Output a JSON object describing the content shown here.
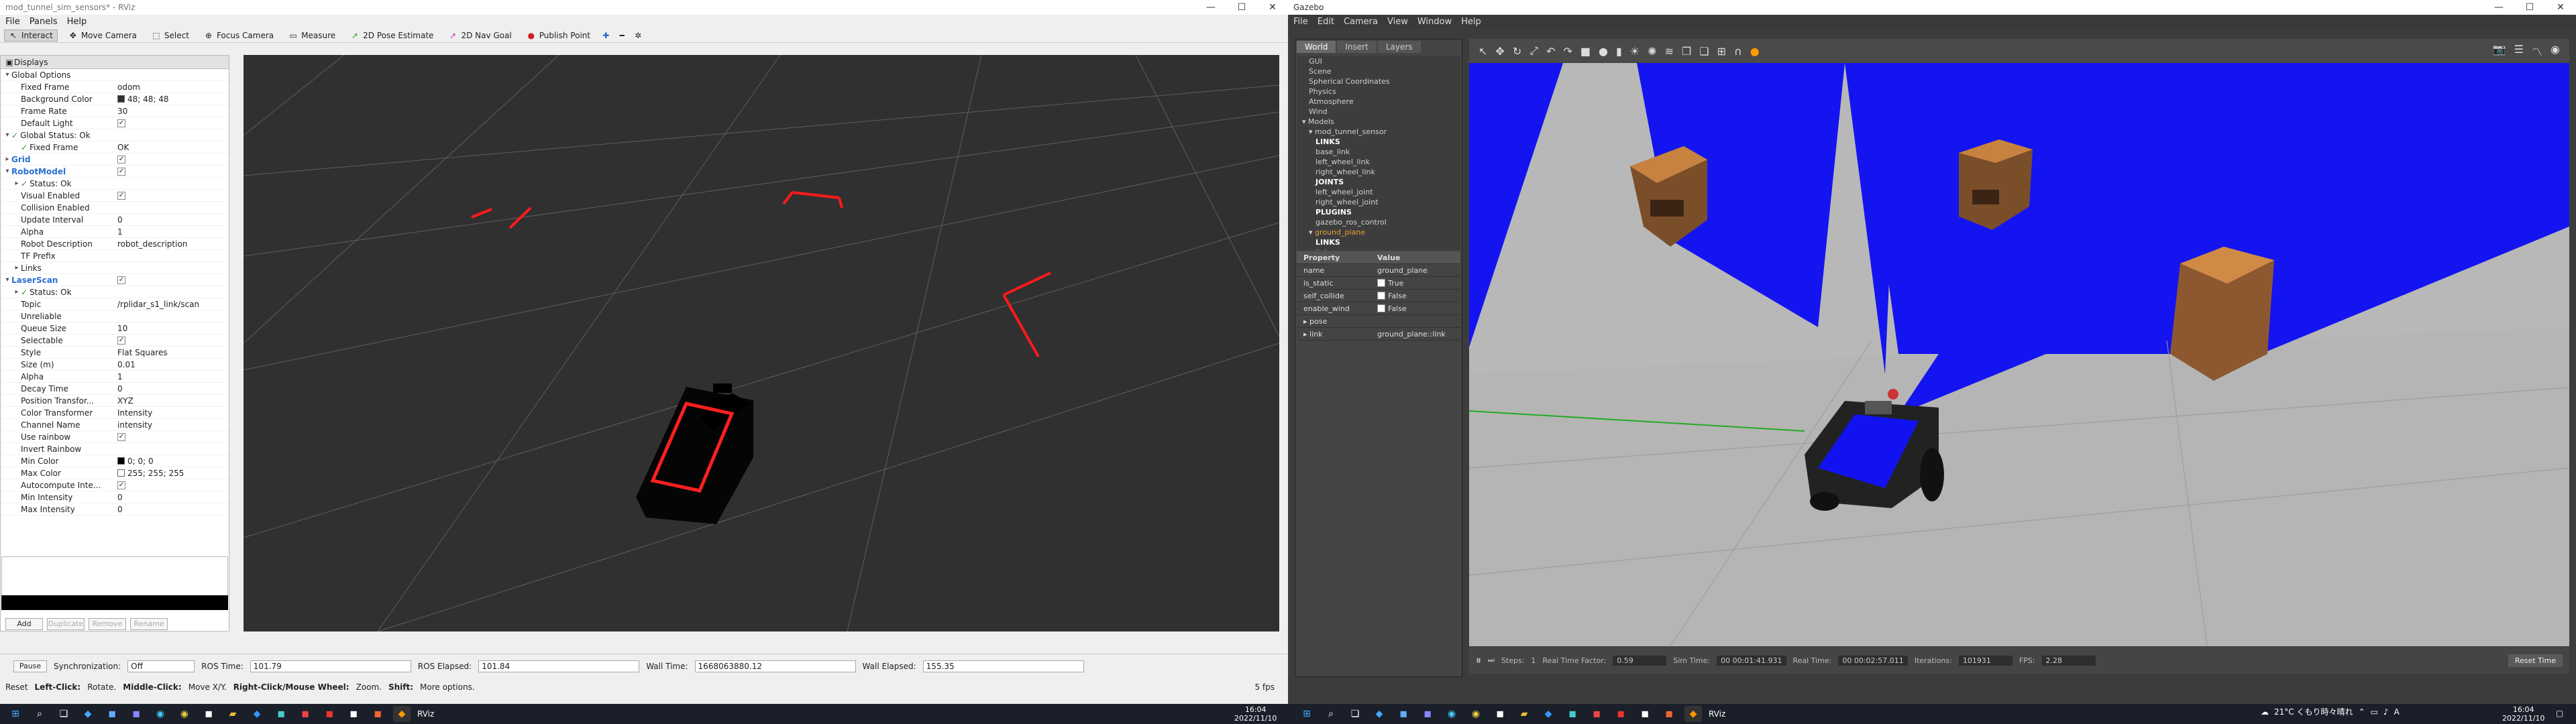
{
  "rviz": {
    "title": "mod_tunnel_sim_sensors* - RViz",
    "menu": [
      "File",
      "Panels",
      "Help"
    ],
    "toolbar": [
      "Interact",
      "Move Camera",
      "Select",
      "Focus Camera",
      "Measure",
      "2D Pose Estimate",
      "2D Nav Goal",
      "Publish Point"
    ],
    "displays_title": "Displays",
    "rows": [
      {
        "n": "Global Options",
        "v": "",
        "lvl": 0,
        "arrow": "▾",
        "icon": "gear"
      },
      {
        "n": "Fixed Frame",
        "v": "odom",
        "lvl": 1
      },
      {
        "n": "Background Color",
        "v": "48; 48; 48",
        "lvl": 1,
        "swatch": "#303030"
      },
      {
        "n": "Frame Rate",
        "v": "30",
        "lvl": 1
      },
      {
        "n": "Default Light",
        "v": "",
        "lvl": 1,
        "check": true
      },
      {
        "n": "Global Status: Ok",
        "v": "",
        "lvl": 0,
        "arrow": "▾",
        "ok": true
      },
      {
        "n": "Fixed Frame",
        "v": "OK",
        "lvl": 1,
        "ok": true
      },
      {
        "n": "Grid",
        "v": "",
        "lvl": 0,
        "arrow": "▸",
        "blue": true,
        "check": true
      },
      {
        "n": "RobotModel",
        "v": "",
        "lvl": 0,
        "arrow": "▾",
        "blue": true,
        "check": true
      },
      {
        "n": "Status: Ok",
        "v": "",
        "lvl": 1,
        "arrow": "▸",
        "ok": true
      },
      {
        "n": "Visual Enabled",
        "v": "",
        "lvl": 1,
        "check": true
      },
      {
        "n": "Collision Enabled",
        "v": "",
        "lvl": 1
      },
      {
        "n": "Update Interval",
        "v": "0",
        "lvl": 1
      },
      {
        "n": "Alpha",
        "v": "1",
        "lvl": 1
      },
      {
        "n": "Robot Description",
        "v": "robot_description",
        "lvl": 1
      },
      {
        "n": "TF Prefix",
        "v": "",
        "lvl": 1
      },
      {
        "n": "Links",
        "v": "",
        "lvl": 1,
        "arrow": "▸"
      },
      {
        "n": "LaserScan",
        "v": "",
        "lvl": 0,
        "arrow": "▾",
        "blue": true,
        "check": true
      },
      {
        "n": "Status: Ok",
        "v": "",
        "lvl": 1,
        "arrow": "▸",
        "ok": true
      },
      {
        "n": "Topic",
        "v": "/rplidar_s1_link/scan",
        "lvl": 1
      },
      {
        "n": "Unreliable",
        "v": "",
        "lvl": 1
      },
      {
        "n": "Queue Size",
        "v": "10",
        "lvl": 1
      },
      {
        "n": "Selectable",
        "v": "",
        "lvl": 1,
        "check": true
      },
      {
        "n": "Style",
        "v": "Flat Squares",
        "lvl": 1
      },
      {
        "n": "Size (m)",
        "v": "0.01",
        "lvl": 1
      },
      {
        "n": "Alpha",
        "v": "1",
        "lvl": 1
      },
      {
        "n": "Decay Time",
        "v": "0",
        "lvl": 1
      },
      {
        "n": "Position Transfor...",
        "v": "XYZ",
        "lvl": 1
      },
      {
        "n": "Color Transformer",
        "v": "Intensity",
        "lvl": 1
      },
      {
        "n": "Channel Name",
        "v": "intensity",
        "lvl": 1
      },
      {
        "n": "Use rainbow",
        "v": "",
        "lvl": 1,
        "check": true
      },
      {
        "n": "Invert Rainbow",
        "v": "",
        "lvl": 1
      },
      {
        "n": "Min Color",
        "v": "0; 0; 0",
        "lvl": 1,
        "swatch": "#000000"
      },
      {
        "n": "Max Color",
        "v": "255; 255; 255",
        "lvl": 1,
        "swatch": "#ffffff"
      },
      {
        "n": "Autocompute Inte...",
        "v": "",
        "lvl": 1,
        "check": true
      },
      {
        "n": "Min Intensity",
        "v": "0",
        "lvl": 1
      },
      {
        "n": "Max Intensity",
        "v": "0",
        "lvl": 1
      }
    ],
    "panel_buttons": [
      "Add",
      "Duplicate",
      "Remove",
      "Rename"
    ],
    "time": {
      "pause": "Pause",
      "sync_label": "Synchronization:",
      "sync_val": "Off",
      "ros_time_label": "ROS Time:",
      "ros_time": "101.79",
      "ros_elapsed_label": "ROS Elapsed:",
      "ros_elapsed": "101.84",
      "wall_time_label": "Wall Time:",
      "wall_time": "1668063880.12",
      "wall_elapsed_label": "Wall Elapsed:",
      "wall_elapsed": "155.35"
    },
    "status": {
      "reset": "Reset",
      "hint_bold1": "Left-Click:",
      "hint1": "Rotate.",
      "hint_bold2": "Middle-Click:",
      "hint2": "Move X/Y.",
      "hint_bold3": "Right-Click/Mouse Wheel:",
      "hint3": "Zoom.",
      "hint_bold4": "Shift:",
      "hint4": "More options.",
      "fps": "5 fps"
    }
  },
  "gazebo": {
    "title": "Gazebo",
    "menu": [
      "File",
      "Edit",
      "Camera",
      "View",
      "Window",
      "Help"
    ],
    "tabs": [
      "World",
      "Insert",
      "Layers"
    ],
    "tree": [
      {
        "t": "GUI",
        "l": 1
      },
      {
        "t": "Scene",
        "l": 1
      },
      {
        "t": "Spherical Coordinates",
        "l": 1
      },
      {
        "t": "Physics",
        "l": 1
      },
      {
        "t": "Atmosphere",
        "l": 1
      },
      {
        "t": "Wind",
        "l": 1
      },
      {
        "t": "Models",
        "l": 0,
        "a": "▾"
      },
      {
        "t": "mod_tunnel_sensor",
        "l": 1,
        "a": "▾"
      },
      {
        "t": "LINKS",
        "l": 2,
        "b": true
      },
      {
        "t": "base_link",
        "l": 2
      },
      {
        "t": "left_wheel_link",
        "l": 2
      },
      {
        "t": "right_wheel_link",
        "l": 2
      },
      {
        "t": "JOINTS",
        "l": 2,
        "b": true
      },
      {
        "t": "left_wheel_joint",
        "l": 2
      },
      {
        "t": "right_wheel_joint",
        "l": 2
      },
      {
        "t": "PLUGINS",
        "l": 2,
        "b": true
      },
      {
        "t": "gazebo_ros_control",
        "l": 2
      },
      {
        "t": "ground_plane",
        "l": 1,
        "a": "▾",
        "o": true
      },
      {
        "t": "LINKS",
        "l": 2,
        "b": true
      },
      {
        "t": "link",
        "l": 2
      }
    ],
    "prop_head": [
      "Property",
      "Value"
    ],
    "props": [
      {
        "p": "name",
        "v": "ground_plane"
      },
      {
        "p": "is_static",
        "v": "True",
        "c": true
      },
      {
        "p": "self_collide",
        "v": "False",
        "c": false
      },
      {
        "p": "enable_wind",
        "v": "False",
        "c": false
      },
      {
        "p": "pose",
        "v": "",
        "a": "▸"
      },
      {
        "p": "link",
        "v": "ground_plane::link",
        "a": "▸"
      }
    ],
    "bottom": {
      "steps_label": "Steps:",
      "steps": "1",
      "rtf_label": "Real Time Factor:",
      "rtf": "0.59",
      "sim_label": "Sim Time:",
      "sim": "00 00:01:41.931",
      "real_label": "Real Time:",
      "real": "00 00:02:57.011",
      "iter_label": "Iterations:",
      "iter": "101931",
      "fps_label": "FPS:",
      "fps": "2.28",
      "reset": "Reset Time"
    }
  },
  "taskbar": {
    "left_label": "RViz",
    "right_label": "RViz",
    "clock_time": "16:04",
    "clock_date": "2022/11/10",
    "weather": "21°C くもり時々晴れ",
    "clock2_time": "16:04",
    "clock2_date": "2022/11/10"
  }
}
